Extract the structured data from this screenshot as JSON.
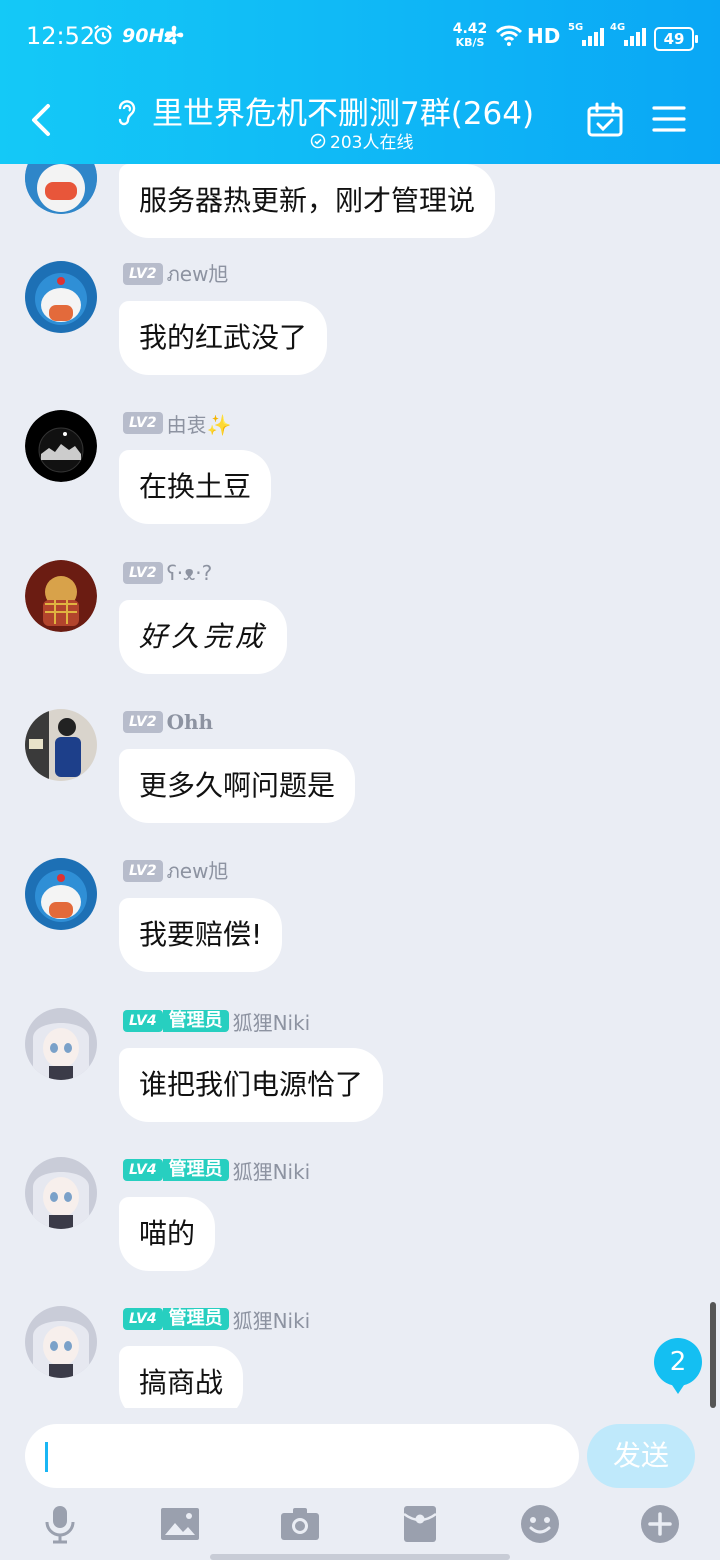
{
  "status_bar": {
    "time": "12:52",
    "refresh_rate": "90Hz",
    "speed_value": "4.42",
    "speed_unit": "KB/S",
    "hd_label": "HD",
    "net1": "5G",
    "net2": "4G",
    "battery": "49"
  },
  "header": {
    "title": "里世界危机不删测7群(264)",
    "online": "203人在线"
  },
  "messages": [
    {
      "text": "服务器热更新，刚才管理说"
    },
    {
      "level": "LV2",
      "name": "ภew旭",
      "text": "我的红武没了"
    },
    {
      "level": "LV2",
      "name": "由衷✨",
      "text": "在换土豆"
    },
    {
      "level": "LV2",
      "name": "ʕ·ᴥ·?",
      "text": "好久完成"
    },
    {
      "level": "LV2",
      "name": "Ohh",
      "text": "更多久啊问题是"
    },
    {
      "level": "LV2",
      "name": "ภew旭",
      "text": "我要赔偿!"
    },
    {
      "level": "LV4",
      "role": "管理员",
      "name": "狐狸Niki",
      "text": "谁把我们电源恰了"
    },
    {
      "level": "LV4",
      "role": "管理员",
      "name": "狐狸Niki",
      "text": "喵的"
    },
    {
      "level": "LV4",
      "role": "管理员",
      "name": "狐狸Niki",
      "text": "搞商战"
    }
  ],
  "unread_count": "2",
  "input": {
    "placeholder": "",
    "send_label": "发送"
  },
  "toolbar_icons": [
    "mic-icon",
    "image-icon",
    "camera-icon",
    "red-packet-icon",
    "emoji-icon",
    "plus-icon"
  ],
  "colors": {
    "header_start": "#14c9f7",
    "header_end": "#0aa7f5",
    "admin_badge": "#27cfc0",
    "accent": "#14bff2"
  }
}
